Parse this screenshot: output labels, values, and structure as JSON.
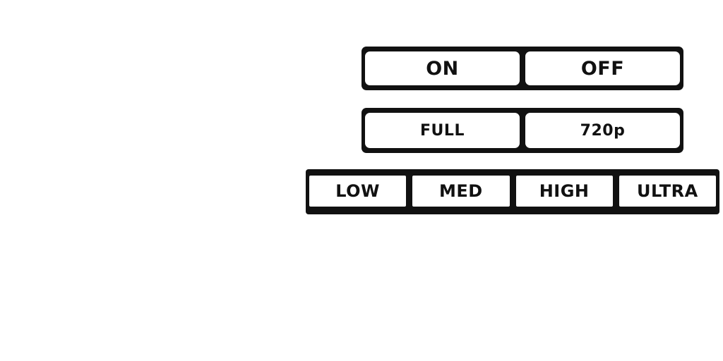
{
  "settings": {
    "power": {
      "options": [
        "ON",
        "OFF"
      ]
    },
    "resolution": {
      "options": [
        "FULL",
        "720p"
      ]
    },
    "quality": {
      "options": [
        "LOW",
        "MED",
        "HIGH",
        "ULTRA"
      ]
    }
  },
  "colors": {
    "bar_background": "#111111",
    "option_background": "#ffffff",
    "text": "#111111"
  }
}
